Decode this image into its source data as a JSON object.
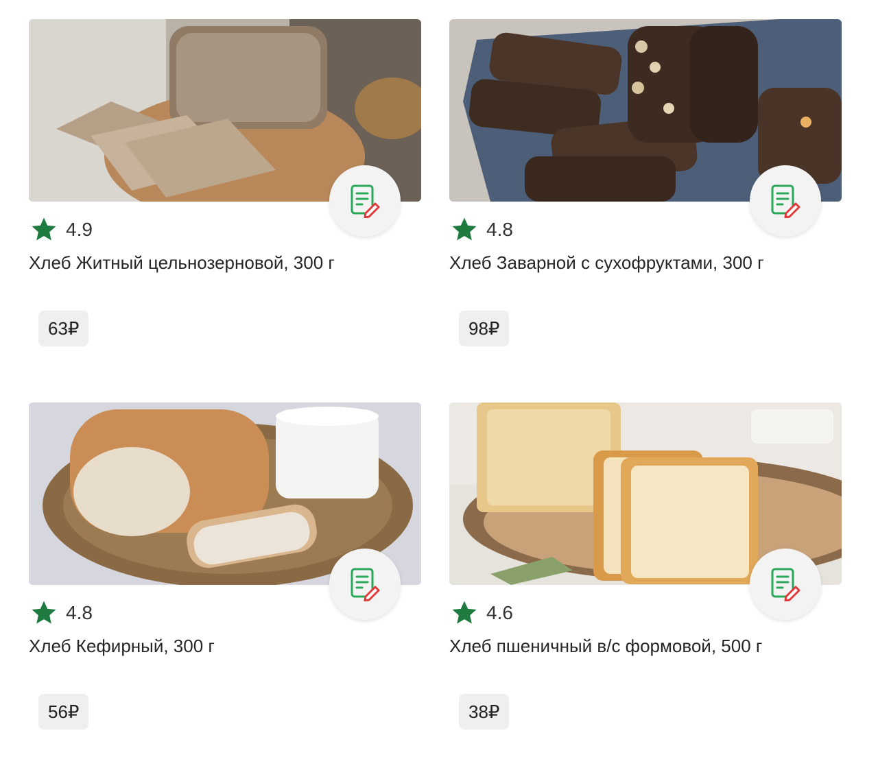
{
  "colors": {
    "accent": "#1f7a3f",
    "icon_green": "#2aa85a",
    "icon_red": "#e03a3a",
    "price_bg": "#efefef",
    "note_btn_bg": "#f3f3f3"
  },
  "products": [
    {
      "rating": "4.9",
      "name": "Хлеб Житный цельнозерновой, 300 г",
      "price": "63₽",
      "icon": "note-edit-icon",
      "image": "rye-bread-photo"
    },
    {
      "rating": "4.8",
      "name": "Хлеб Заварной с сухофруктами, 300 г",
      "price": "98₽",
      "icon": "note-edit-icon",
      "image": "dark-fruit-bread-photo"
    },
    {
      "rating": "4.8",
      "name": "Хлеб Кефирный, 300 г",
      "price": "56₽",
      "icon": "note-edit-icon",
      "image": "kefir-bread-photo"
    },
    {
      "rating": "4.6",
      "name": "Хлеб пшеничный в/с формовой, 500 г",
      "price": "38₽",
      "icon": "note-edit-icon",
      "image": "wheat-bread-photo"
    }
  ]
}
